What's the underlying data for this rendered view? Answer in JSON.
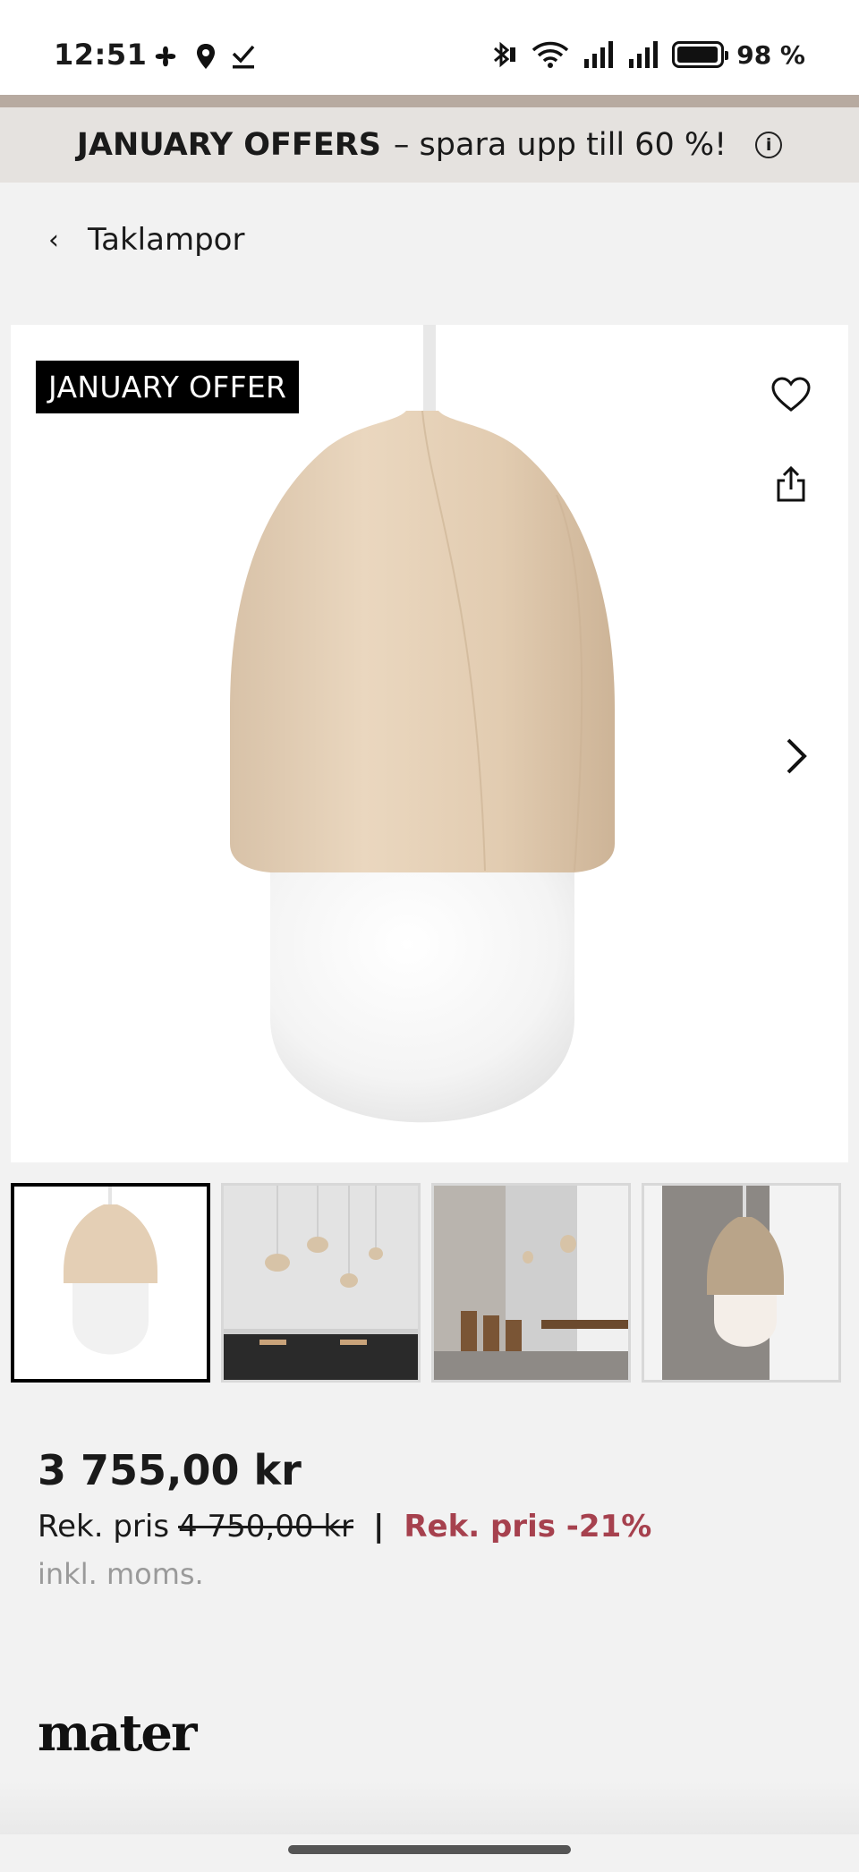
{
  "status_bar": {
    "time": "12:51",
    "battery_text": "98 %",
    "battery_level": 0.98,
    "icons": [
      "fan-icon",
      "location-icon",
      "check-icon",
      "bluetooth-icon",
      "wifi-icon",
      "signal-icon",
      "signal-icon",
      "battery-icon"
    ]
  },
  "promo": {
    "bold": "JANUARY OFFERS",
    "text": "– spara upp till 60 %!",
    "info_icon": "info-icon"
  },
  "breadcrumb": {
    "back_icon": "chevron-left-icon",
    "label": "Taklampor"
  },
  "product": {
    "badge": "JANUARY OFFER",
    "favorite_icon": "heart-icon",
    "share_icon": "share-icon",
    "next_icon": "chevron-right-icon",
    "thumbnails_count": 4,
    "active_thumbnail": 0
  },
  "pricing": {
    "price": "3 755,00 kr",
    "rek_label": "Rek. pris",
    "rek_old": "4 750,00 kr",
    "separator": "|",
    "discount": "Rek. pris -21%",
    "discount_color": "#a6414e",
    "vat": "inkl. moms."
  },
  "brand": {
    "logo": "mater"
  }
}
